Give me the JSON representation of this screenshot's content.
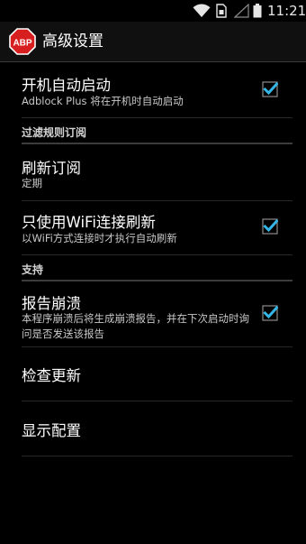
{
  "status_bar": {
    "time": "11:21",
    "icons": [
      "wifi-icon",
      "sim-card-icon",
      "signal-icon",
      "battery-icon"
    ]
  },
  "action_bar": {
    "logo_text": "ABP",
    "title": "高级设置"
  },
  "preferences": {
    "auto_start": {
      "title": "开机自动启动",
      "summary": "Adblock Plus 将在开机时自动启动",
      "checked": true
    },
    "filter_category": "过滤规则订阅",
    "refresh": {
      "title": "刷新订阅",
      "summary": "定期"
    },
    "wifi_only": {
      "title": "只使用WiFi连接刷新",
      "summary": "以WiFi方式连接时才执行自动刷新",
      "checked": true
    },
    "support_category": "支持",
    "crash_report": {
      "title": "报告崩溃",
      "summary": "本程序崩溃后将生成崩溃报告，并在下次启动时询问是否发送该报告",
      "checked": true
    },
    "check_updates": {
      "title": "检查更新"
    },
    "show_config": {
      "title": "显示配置"
    }
  },
  "colors": {
    "background": "#000000",
    "checkmark": "#33b5e5",
    "abp_red": "#d81f1f"
  }
}
